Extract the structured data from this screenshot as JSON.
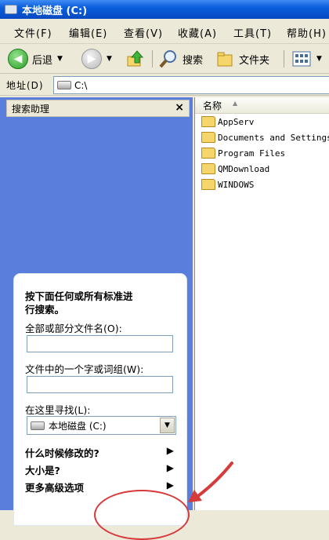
{
  "window": {
    "title": "本地磁盘 (C:)"
  },
  "menu": [
    "文件(F)",
    "编辑(E)",
    "查看(V)",
    "收藏(A)",
    "工具(T)",
    "帮助(H)"
  ],
  "toolbar": {
    "back_label": "后退",
    "search_label": "搜索",
    "folders_label": "文件夹"
  },
  "address": {
    "label": "地址(D)",
    "value": "C:\\"
  },
  "search_pane": {
    "title": "搜索助理",
    "close": "×",
    "instructions": [
      "按下面任何或所有标准进",
      "行搜索。"
    ],
    "filename_label": "全部或部分文件名(O):",
    "filename_value": "",
    "phrase_label": "文件中的一个字或词组(W):",
    "phrase_value": "",
    "lookin_label": "在这里寻找(L):",
    "lookin_value": "本地磁盘 (C:)",
    "options": [
      "什么时候修改的?",
      "大小是?",
      "更多高级选项"
    ]
  },
  "file_list": {
    "column_name": "名称",
    "items": [
      "AppServ",
      "Documents and Settings",
      "Program Files",
      "QMDownload",
      "WINDOWS"
    ]
  },
  "colors": {
    "title_bar": "#0a5ddc",
    "search_pane": "#5a7edc",
    "annotation": "#d63a3a"
  }
}
